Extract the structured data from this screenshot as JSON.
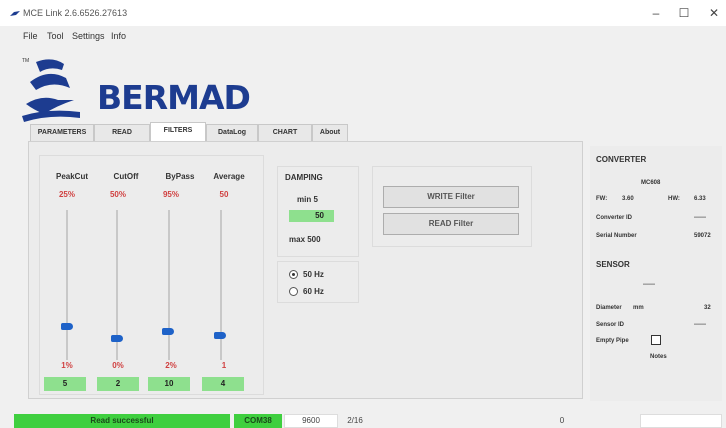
{
  "window": {
    "title": "MCE Link 2.6.6526.27613",
    "minimize": "–",
    "maximize": "☐",
    "close": "✕"
  },
  "menu": [
    "File",
    "Tool",
    "Settings",
    "Info"
  ],
  "logo": {
    "text": "BERMAD",
    "tm": "TM",
    "color": "#1d3c90"
  },
  "tabs": [
    "PARAMETERS",
    "READ",
    "FILTERS",
    "DataLog",
    "CHART",
    "About"
  ],
  "active_tab": "FILTERS",
  "filters": [
    {
      "name": "PeakCut",
      "percent": "25%",
      "min": "1%",
      "value": "5"
    },
    {
      "name": "CutOff",
      "percent": "50%",
      "min": "0%",
      "value": "2"
    },
    {
      "name": "ByPass",
      "percent": "95%",
      "min": "2%",
      "value": "10"
    },
    {
      "name": "Average",
      "percent": "50",
      "min": "1",
      "value": "4"
    }
  ],
  "damping": {
    "title": "DAMPING",
    "min_label": "min 5",
    "value": "50",
    "max_label": "max 500"
  },
  "frequency": {
    "options": [
      "50 Hz",
      "60 Hz"
    ],
    "selected": "50 Hz"
  },
  "buttons": {
    "write": "WRITE Filter",
    "read": "READ Filter"
  },
  "converter": {
    "title": "CONVERTER",
    "model": "MC608",
    "fw_label": "FW:",
    "fw_value": "3.60",
    "hw_label": "HW:",
    "hw_value": "6.33",
    "id_label": "Converter ID",
    "id_value": "------",
    "serial_label": "Serial Number",
    "serial_value": "59072"
  },
  "sensor": {
    "title": "SENSOR",
    "line": "------",
    "diameter_label": "Diameter",
    "diameter_unit": "mm",
    "diameter_value": "32",
    "id_label": "Sensor ID",
    "id_value": "------",
    "empty_pipe_label": "Empty Pipe",
    "notes_label": "Notes"
  },
  "status": {
    "message": "Read successful",
    "port": "COM38",
    "baud": "9600",
    "frame": "2/16",
    "count": "0"
  },
  "colors": {
    "accent_blue": "#1e62c8",
    "value_green": "#8ee08e",
    "status_green": "#3fcf3f",
    "percent_red": "#d04040"
  }
}
